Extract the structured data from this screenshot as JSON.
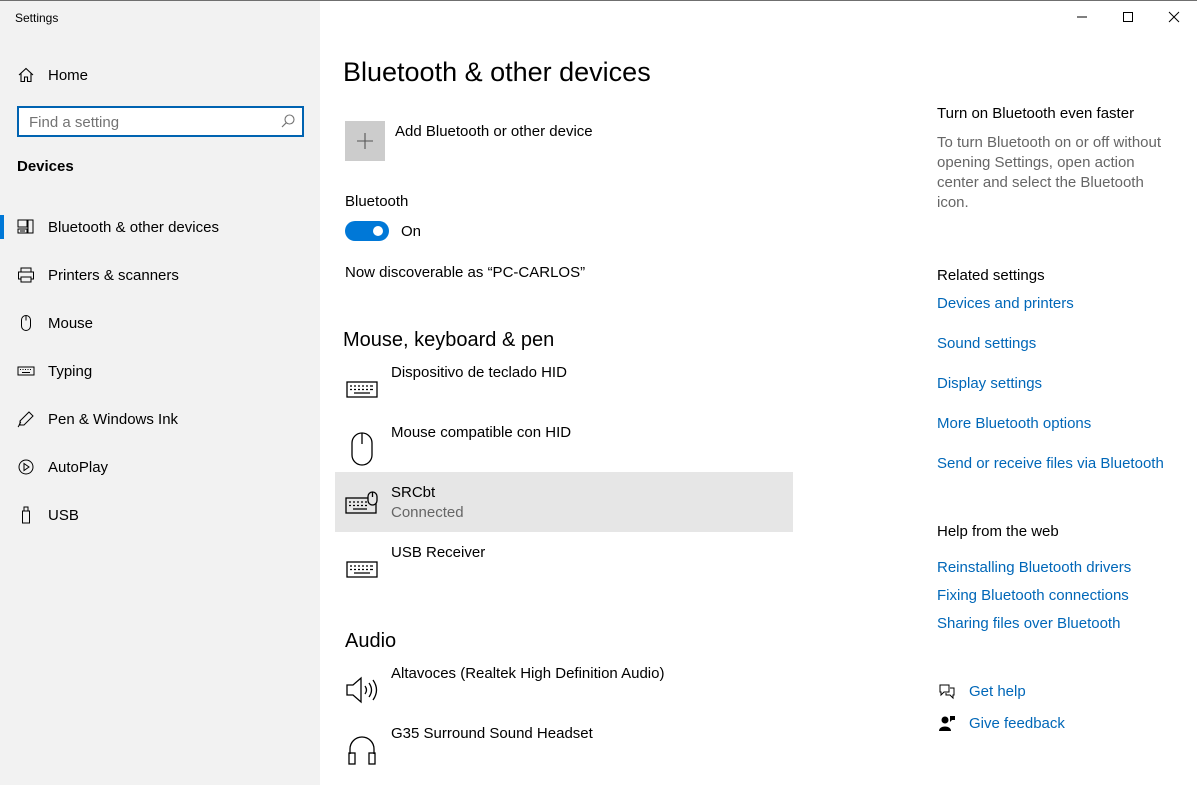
{
  "window": {
    "title": "Settings"
  },
  "sidebar": {
    "home_label": "Home",
    "search_placeholder": "Find a setting",
    "section_title": "Devices",
    "items": [
      {
        "label": "Bluetooth & other devices",
        "icon": "bluetooth-devices-icon",
        "active": true
      },
      {
        "label": "Printers & scanners",
        "icon": "printer-icon"
      },
      {
        "label": "Mouse",
        "icon": "mouse-icon"
      },
      {
        "label": "Typing",
        "icon": "keyboard-icon"
      },
      {
        "label": "Pen & Windows Ink",
        "icon": "pen-icon"
      },
      {
        "label": "AutoPlay",
        "icon": "autoplay-icon"
      },
      {
        "label": "USB",
        "icon": "usb-icon"
      }
    ]
  },
  "main": {
    "title": "Bluetooth & other devices",
    "add_device_label": "Add Bluetooth or other device",
    "bluetooth_label": "Bluetooth",
    "bluetooth_state": "On",
    "discoverable_text": "Now discoverable as “PC-CARLOS”",
    "mkp_section": {
      "title": "Mouse, keyboard & pen",
      "devices": [
        {
          "name": "Dispositivo de teclado HID",
          "status": "",
          "icon": "keyboard-icon"
        },
        {
          "name": "Mouse compatible con HID",
          "status": "",
          "icon": "mouse-icon"
        },
        {
          "name": "SRCbt",
          "status": "Connected",
          "icon": "keyboard-mouse-icon"
        },
        {
          "name": "USB Receiver",
          "status": "",
          "icon": "keyboard-icon"
        }
      ]
    },
    "audio_section": {
      "title": "Audio",
      "devices": [
        {
          "name": "Altavoces (Realtek High Definition Audio)",
          "icon": "speaker-icon"
        },
        {
          "name": "G35 Surround Sound Headset",
          "icon": "headset-icon"
        }
      ]
    }
  },
  "right": {
    "tip_title": "Turn on Bluetooth even faster",
    "tip_text": "To turn Bluetooth on or off without opening Settings, open action center and select the Bluetooth icon.",
    "related_title": "Related settings",
    "related_links": [
      "Devices and printers",
      "Sound settings",
      "Display settings",
      "More Bluetooth options",
      "Send or receive files via Bluetooth"
    ],
    "help_title": "Help from the web",
    "help_links": [
      "Reinstalling Bluetooth drivers",
      "Fixing Bluetooth connections",
      "Sharing files over Bluetooth"
    ],
    "get_help": "Get help",
    "give_feedback": "Give feedback"
  },
  "colors": {
    "accent": "#0078d7",
    "link": "#0067b8",
    "sidebar_bg": "#f2f2f2",
    "selected_bg": "#e6e6e6"
  }
}
